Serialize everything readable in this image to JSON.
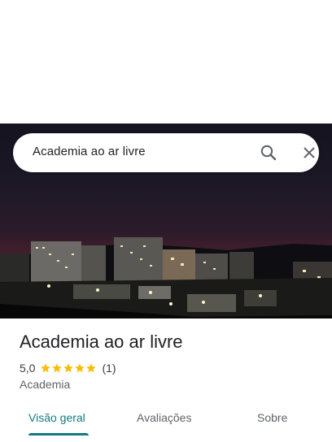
{
  "search": {
    "query": "Academia ao ar livre"
  },
  "place": {
    "title": "Academia ao ar livre",
    "rating": "5,0",
    "stars": 5,
    "review_count": "(1)",
    "category": "Academia"
  },
  "tabs": [
    {
      "label": "Visão geral",
      "active": true
    },
    {
      "label": "Avaliações",
      "active": false
    },
    {
      "label": "Sobre",
      "active": false
    }
  ],
  "colors": {
    "accent": "#137a7f",
    "star": "#fbbc04"
  }
}
